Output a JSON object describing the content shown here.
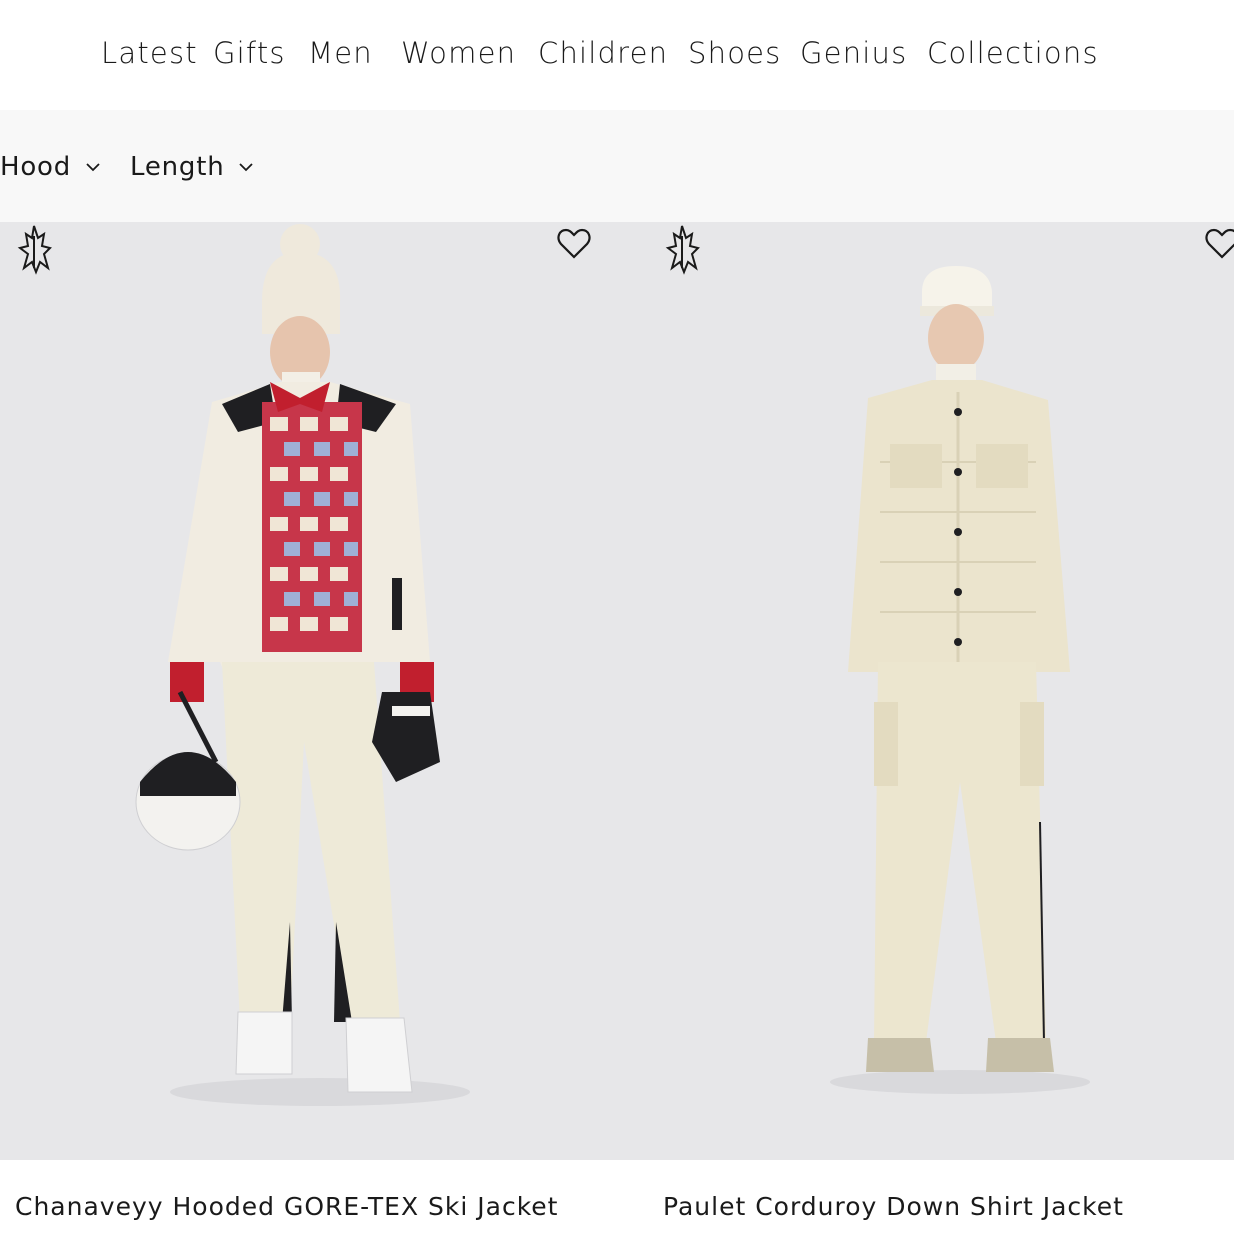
{
  "nav": {
    "items": [
      {
        "label": "Latest"
      },
      {
        "label": "Gifts"
      },
      {
        "label": "Men"
      },
      {
        "label": "Women"
      },
      {
        "label": "Children"
      },
      {
        "label": "Shoes"
      },
      {
        "label": "Genius"
      },
      {
        "label": "Collections"
      }
    ]
  },
  "filters": [
    {
      "label": "Hood",
      "icon": "chevron-down-icon"
    },
    {
      "label": "Length",
      "icon": "chevron-down-icon"
    }
  ],
  "products": [
    {
      "title": "Chanaveyy Hooded GORE-TEX Ski Jacket",
      "brand_icon": "grenoble-logo-icon",
      "wishlist_icon": "heart-icon"
    },
    {
      "title": "Paulet Corduroy Down Shirt Jacket",
      "brand_icon": "grenoble-logo-icon",
      "wishlist_icon": "heart-icon"
    }
  ],
  "colors": {
    "background": "#ffffff",
    "filter_bar": "#f8f8f8",
    "image_backdrop": "#e7e7e9",
    "text": "#1a1a1a"
  }
}
